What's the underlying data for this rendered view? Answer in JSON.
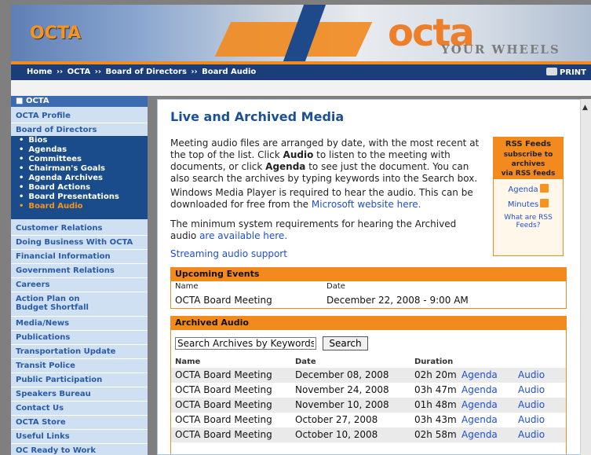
{
  "header": {
    "brand_left": "OCTA",
    "logo_main": "octa",
    "logo_tag": "YOUR WHEELS"
  },
  "breadcrumb": {
    "items": [
      "Home",
      "OCTA",
      "Board of Directors",
      "Board Audio"
    ],
    "separator": "››",
    "print_label": "PRINT"
  },
  "sidebar": {
    "header": "OCTA",
    "items_top": [
      "OCTA Profile"
    ],
    "board_label": "Board of Directors",
    "board_subitems": [
      "Bios",
      "Agendas",
      "Committees",
      "Chairman's Goals",
      "Agenda Archives",
      "Board Actions",
      "Board Presentations",
      "Board Audio"
    ],
    "active_subitem": "Board Audio",
    "items_bottom": [
      "Customer Relations",
      "Doing Business With OCTA",
      "Financial Information",
      "Government Relations",
      "Careers",
      "Action Plan on Budget Shortfall",
      "Media/News",
      "Publications",
      "Transportation Update",
      "Transit Police",
      "Public Participation",
      "Speakers Bureau",
      "Contact Us",
      "OCTA Store",
      "Useful Links",
      "OC Ready to Work"
    ]
  },
  "content": {
    "title": "Live and Archived Media",
    "p1_a": "Meeting audio files are arranged by date, with the most recent at the top of the list. Click ",
    "p1_audio": "Audio",
    "p1_b": " to listen to the meeting with documents, or click ",
    "p1_agenda": "Agenda",
    "p1_c": " to see just the document. You can also search the archives by typing keywords into the Search box.",
    "p2_a": "Windows Media Player is required to hear the audio. This can be downloaded for free from the ",
    "p2_link": "Microsoft website here.",
    "p3_a": "The minimum system requirements for hearing the Archived audio ",
    "p3_link": "are available here.",
    "streaming_link": "Streaming audio support"
  },
  "rss": {
    "head": "RSS Feeds",
    "sub1": "subscribe to",
    "sub2": "archives",
    "sub3": "via RSS feeds",
    "agenda": "Agenda",
    "minutes": "Minutes",
    "help": "What are RSS Feeds?"
  },
  "upcoming": {
    "title": "Upcoming Events",
    "col_name": "Name",
    "col_date": "Date",
    "name": "OCTA Board Meeting",
    "date": "December 22, 2008 - 9:00 AM"
  },
  "archived": {
    "title": "Archived Audio",
    "search_placeholder": "Search Archives by Keywords",
    "search_button": "Search",
    "col_name": "Name",
    "col_date": "Date",
    "col_duration": "Duration",
    "rows": [
      {
        "name": "OCTA Board Meeting",
        "date": "December 08, 2008",
        "duration": "02h 20m",
        "agenda": "Agenda",
        "audio": "Audio"
      },
      {
        "name": "OCTA Board Meeting",
        "date": "November 24, 2008",
        "duration": "03h 47m",
        "agenda": "Agenda",
        "audio": "Audio"
      },
      {
        "name": "OCTA Board Meeting",
        "date": "November 10, 2008",
        "duration": "01h 48m",
        "agenda": "Agenda",
        "audio": "Audio"
      },
      {
        "name": "OCTA Board Meeting",
        "date": "October 27, 2008",
        "duration": "03h 43m",
        "agenda": "Agenda",
        "audio": "Audio"
      },
      {
        "name": "OCTA Board Meeting",
        "date": "October 10, 2008",
        "duration": "02h 58m",
        "agenda": "Agenda",
        "audio": "Audio"
      }
    ]
  }
}
